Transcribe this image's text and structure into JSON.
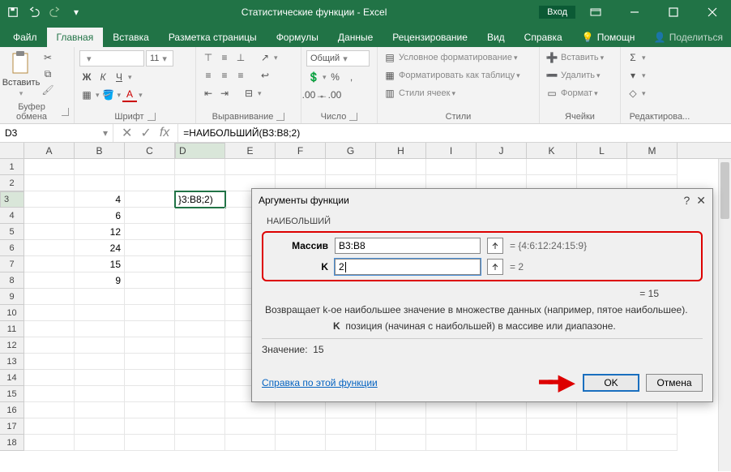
{
  "titlebar": {
    "title": "Статистические функции - Excel",
    "login": "Вход"
  },
  "tabs": [
    "Файл",
    "Главная",
    "Вставка",
    "Разметка страницы",
    "Формулы",
    "Данные",
    "Рецензирование",
    "Вид",
    "Справка",
    "Помощн"
  ],
  "share": "Поделиться",
  "ribbon": {
    "clipboard": {
      "paste": "Вставить",
      "title": "Буфер обмена"
    },
    "font": {
      "name": "",
      "size": "11",
      "title": "Шрифт",
      "bold": "Ж",
      "italic": "К",
      "underline": "Ч"
    },
    "align": {
      "title": "Выравнивание"
    },
    "number": {
      "format": "Общий",
      "title": "Число"
    },
    "styles": {
      "cond": "Условное форматирование",
      "table": "Форматировать как таблицу",
      "cell": "Стили ячеек",
      "title": "Стили"
    },
    "cells": {
      "insert": "Вставить",
      "delete": "Удалить",
      "format": "Формат",
      "title": "Ячейки"
    },
    "editing": {
      "title": "Редактирова..."
    }
  },
  "namebox": "D3",
  "formula": "=НАИБОЛЬШИЙ(B3:B8;2)",
  "columns": [
    "A",
    "B",
    "C",
    "D",
    "E",
    "F",
    "G",
    "H",
    "I",
    "J",
    "K",
    "L",
    "M"
  ],
  "rownums": [
    1,
    2,
    3,
    4,
    5,
    6,
    7,
    8,
    9,
    10,
    11,
    12,
    13,
    14,
    15,
    16,
    17,
    18
  ],
  "cells": {
    "B3": "4",
    "B4": "6",
    "B5": "12",
    "B6": "24",
    "B7": "15",
    "B8": "9",
    "D3": "}3:B8;2)"
  },
  "dialog": {
    "title": "Аргументы функции",
    "fn": "НАИБОЛЬШИЙ",
    "args": {
      "array_label": "Массив",
      "array_value": "B3:B8",
      "array_eval": "= {4:6:12:24:15:9}",
      "k_label": "K",
      "k_value": "2",
      "k_eval": "= 2"
    },
    "result": "= 15",
    "desc": "Возвращает k-ое наибольшее значение в множестве данных (например, пятое наибольшее).",
    "desc2_label": "K",
    "desc2": "позиция (начиная с наибольшей) в массиве или диапазоне.",
    "value_label": "Значение:",
    "value": "15",
    "help": "Справка по этой функции",
    "ok": "OK",
    "cancel": "Отмена"
  }
}
